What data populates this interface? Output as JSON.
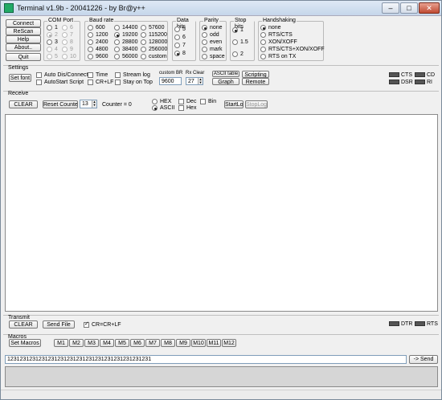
{
  "window": {
    "title": "Terminal v1.9b - 20041226 - by Br@y++"
  },
  "left_buttons": {
    "connect": "Connect",
    "rescan": "ReScan",
    "help": "Help",
    "about": "About..",
    "quit": "Quit"
  },
  "com_port": {
    "label": "COM Port",
    "options": [
      "1",
      "2",
      "3",
      "4",
      "5",
      "6",
      "7",
      "8",
      "9",
      "10"
    ],
    "selected": "2"
  },
  "baud_rate": {
    "label": "Baud rate",
    "options": [
      "600",
      "1200",
      "2400",
      "4800",
      "9600",
      "14400",
      "19200",
      "28800",
      "38400",
      "56000",
      "57600",
      "115200",
      "128000",
      "256000",
      "custom"
    ],
    "selected": "19200"
  },
  "data_bits": {
    "label": "Data bits",
    "options": [
      "5",
      "6",
      "7",
      "8"
    ],
    "selected": "8"
  },
  "parity": {
    "label": "Parity",
    "options": [
      "none",
      "odd",
      "even",
      "mark",
      "space"
    ],
    "selected": "none"
  },
  "stop_bits": {
    "label": "Stop bits",
    "options": [
      "1",
      "1.5",
      "2"
    ],
    "selected": "1"
  },
  "handshaking": {
    "label": "Handshaking",
    "options": [
      "none",
      "RTS/CTS",
      "XON/XOFF",
      "RTS/CTS+XON/XOFF",
      "RTS on TX"
    ],
    "selected": "none"
  },
  "settings": {
    "label": "Settings",
    "set_font": "Set font",
    "auto_dis_connect": "Auto Dis/Connect",
    "autostart_script": "AutoStart Script",
    "time": "Time",
    "crlf": "CR+LF",
    "stream_log": "Stream log",
    "stay_on_top": "Stay on Top",
    "custom_br_label": "custom BR",
    "custom_br_value": "9600",
    "rx_clear_label": "Rx Clear",
    "rx_clear_value": "27",
    "ascii_table": "ASCII table",
    "graph": "Graph",
    "scripting": "Scripting",
    "remote": "Remote"
  },
  "status_leds": {
    "cts": "CTS",
    "cd": "CD",
    "dsr": "DSR",
    "ri": "RI",
    "dtr": "DTR",
    "rts": "RTS"
  },
  "receive": {
    "label": "Receive",
    "clear": "CLEAR",
    "reset_counter": "Reset Counter",
    "counter_spin": "13",
    "counter_text": "Counter = 0",
    "hex": "HEX",
    "ascii": "ASCII",
    "dec": "Dec",
    "hex2": "Hex",
    "bin": "Bin",
    "startlog": "StartLog",
    "stoplog": "StopLog"
  },
  "transmit": {
    "label": "Transmit",
    "clear": "CLEAR",
    "send_file": "Send File",
    "cr_crlf": "CR=CR+LF"
  },
  "macros": {
    "label": "Macros",
    "set_macros": "Set Macros",
    "items": [
      "M1",
      "M2",
      "M3",
      "M4",
      "M5",
      "M6",
      "M7",
      "M8",
      "M9",
      "M10",
      "M11",
      "M12"
    ]
  },
  "send": {
    "input_value": "1231231231231231231231231231231231231231231231",
    "send_label": "-> Send"
  }
}
